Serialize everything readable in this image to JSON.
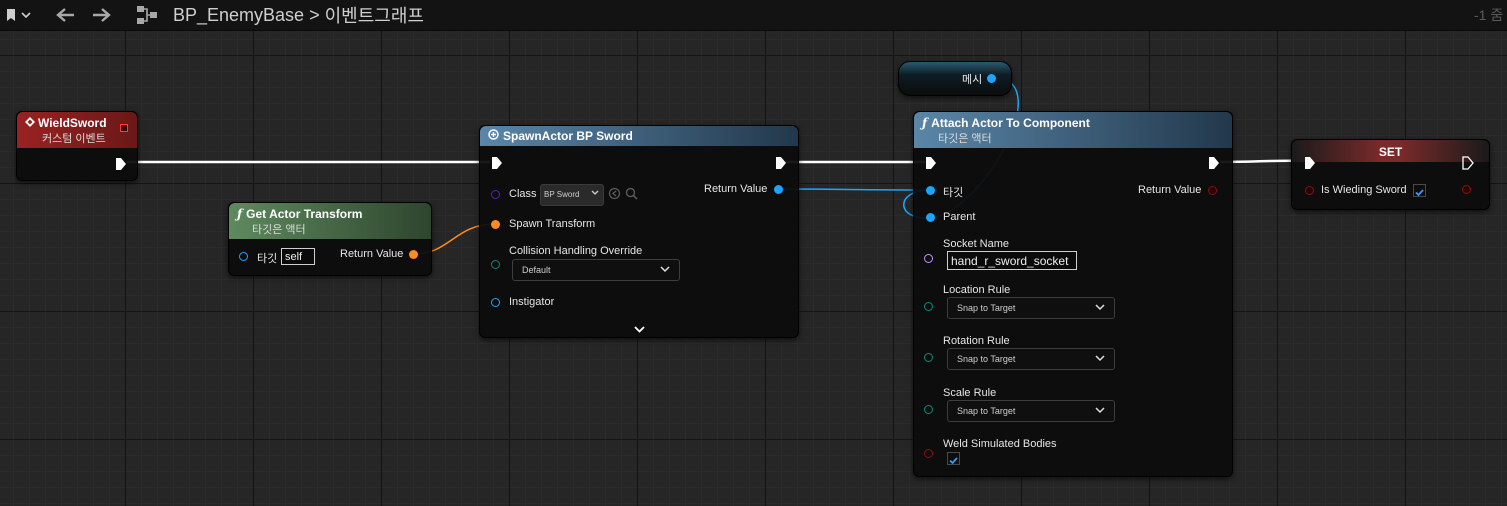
{
  "topbar": {
    "title": "BP_EnemyBase",
    "breadcrumb_sep": ">",
    "graph": "이벤트그래프",
    "zoom": "-1 줌",
    "icons": [
      "bookmark-icon",
      "chevron-down-icon",
      "back-arrow-icon",
      "forward-arrow-icon",
      "graph-icon"
    ]
  },
  "nodes": {
    "wield": {
      "title": "WieldSword",
      "subtitle": "커스텀 이벤트",
      "color": "#8a1c1c"
    },
    "get_transform": {
      "title": "Get Actor Transform",
      "subtitle": "타깃은 액터",
      "target_label": "타깃",
      "target_value": "self",
      "return_label": "Return Value",
      "color": "#3e5e3e"
    },
    "spawn": {
      "title": "SpawnActor BP Sword",
      "class_label": "Class",
      "class_value": "BP Sword",
      "spawn_transform_label": "Spawn Transform",
      "collision_label": "Collision Handling Override",
      "collision_value": "Default",
      "instigator_label": "Instigator",
      "return_label": "Return Value",
      "color": "#3f5f78"
    },
    "mesh": {
      "label": "메시"
    },
    "attach": {
      "title": "Attach Actor To Component",
      "subtitle": "타깃은 액터",
      "target_label": "타깃",
      "parent_label": "Parent",
      "return_label": "Return Value",
      "socket_label": "Socket Name",
      "socket_value": "hand_r_sword_socket",
      "location_label": "Location Rule",
      "location_value": "Snap to Target",
      "rotation_label": "Rotation Rule",
      "rotation_value": "Snap to Target",
      "scale_label": "Scale Rule",
      "scale_value": "Snap to Target",
      "weld_label": "Weld Simulated Bodies",
      "weld_checked": true,
      "color": "#3f5f78"
    },
    "set": {
      "title": "SET",
      "var_label": "Is Wieding Sword",
      "var_checked": true,
      "color": "#7a2a2a"
    }
  },
  "pin_colors": {
    "exec": "#ffffff",
    "object": "#1aa6ff",
    "struct": "#ff8c1a",
    "class": "#5a1ec8",
    "enum": "#0a8a7a",
    "bool": "#8a1010",
    "name": "#c890ff"
  }
}
